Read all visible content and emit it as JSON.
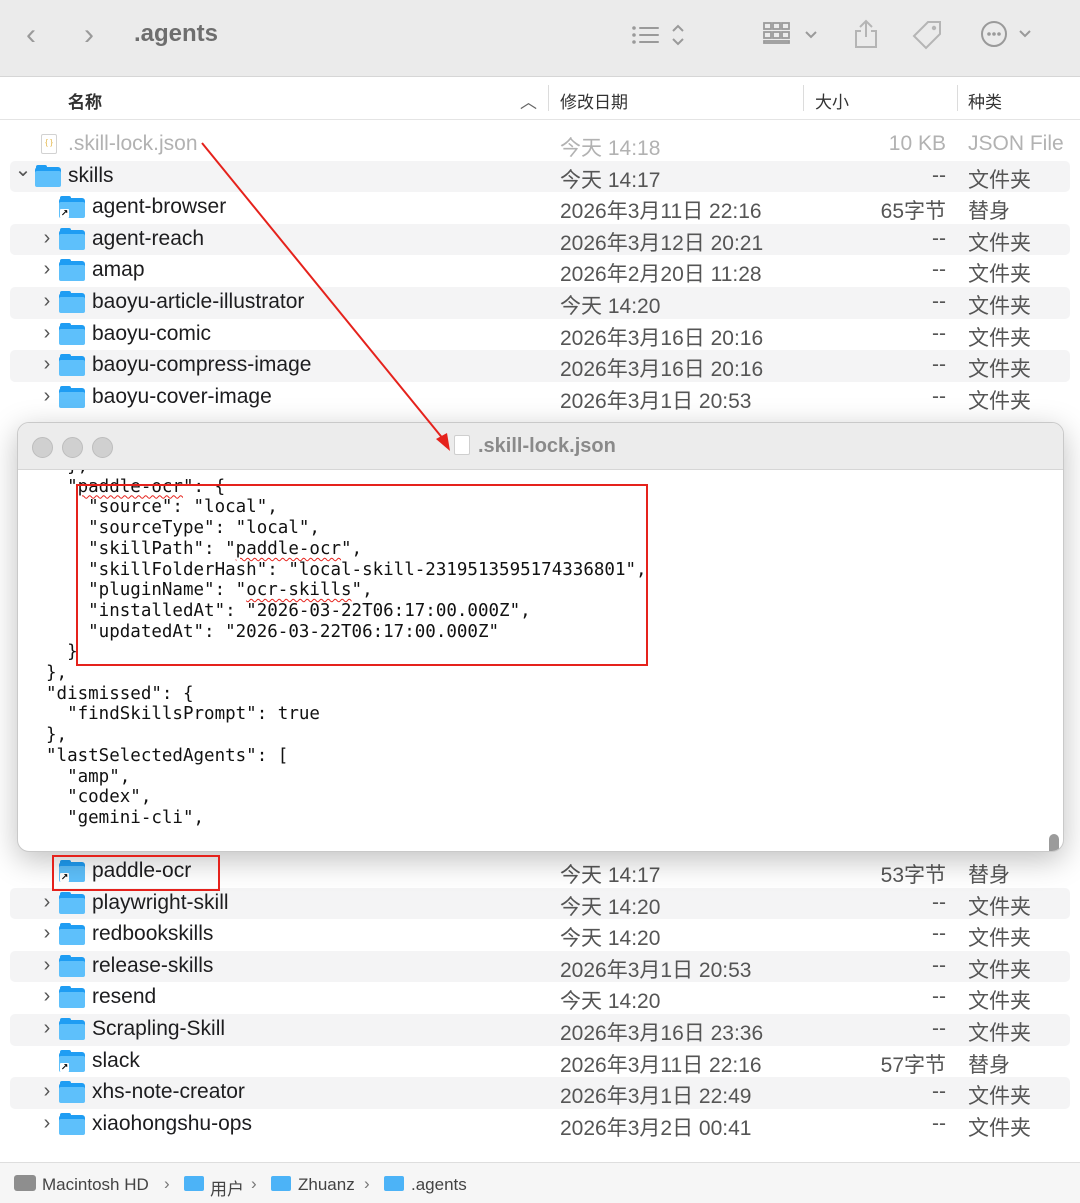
{
  "window": {
    "title": ".agents",
    "back_glyph": "‹",
    "forward_glyph": "›"
  },
  "columns": {
    "name": "名称",
    "date": "修改日期",
    "size": "大小",
    "kind": "种类",
    "sort_glyph": "︿"
  },
  "rows_top": [
    {
      "name": ".skill-lock.json",
      "date": "今天 14:18",
      "size": "10 KB",
      "kind": "JSON File",
      "type": "json",
      "dim": true
    },
    {
      "name": "skills",
      "date": "今天 14:17",
      "size": "--",
      "kind": "文件夹",
      "type": "folder-open"
    },
    {
      "name": "agent-browser",
      "date": "2026年3月11日 22:16",
      "size": "65字节",
      "kind": "替身",
      "type": "alias"
    },
    {
      "name": "agent-reach",
      "date": "2026年3月12日 20:21",
      "size": "--",
      "kind": "文件夹",
      "type": "folder"
    },
    {
      "name": "amap",
      "date": "2026年2月20日 11:28",
      "size": "--",
      "kind": "文件夹",
      "type": "folder"
    },
    {
      "name": "baoyu-article-illustrator",
      "date": "今天 14:20",
      "size": "--",
      "kind": "文件夹",
      "type": "folder"
    },
    {
      "name": "baoyu-comic",
      "date": "2026年3月16日 20:16",
      "size": "--",
      "kind": "文件夹",
      "type": "folder"
    },
    {
      "name": "baoyu-compress-image",
      "date": "2026年3月16日 20:16",
      "size": "--",
      "kind": "文件夹",
      "type": "folder"
    },
    {
      "name": "baoyu-cover-image",
      "date": "2026年3月1日 20:53",
      "size": "--",
      "kind": "文件夹",
      "type": "folder"
    }
  ],
  "rows_bottom": [
    {
      "name": "paddle-ocr",
      "date": "今天 14:17",
      "size": "53字节",
      "kind": "替身",
      "type": "alias"
    },
    {
      "name": "playwright-skill",
      "date": "今天 14:20",
      "size": "--",
      "kind": "文件夹",
      "type": "folder"
    },
    {
      "name": "redbookskills",
      "date": "今天 14:20",
      "size": "--",
      "kind": "文件夹",
      "type": "folder"
    },
    {
      "name": "release-skills",
      "date": "2026年3月1日 20:53",
      "size": "--",
      "kind": "文件夹",
      "type": "folder"
    },
    {
      "name": "resend",
      "date": "今天 14:20",
      "size": "--",
      "kind": "文件夹",
      "type": "folder"
    },
    {
      "name": "Scrapling-Skill",
      "date": "2026年3月16日 23:36",
      "size": "--",
      "kind": "文件夹",
      "type": "folder"
    },
    {
      "name": "slack",
      "date": "2026年3月11日 22:16",
      "size": "57字节",
      "kind": "替身",
      "type": "alias"
    },
    {
      "name": "xhs-note-creator",
      "date": "2026年3月1日 22:49",
      "size": "--",
      "kind": "文件夹",
      "type": "folder"
    },
    {
      "name": "xiaohongshu-ops",
      "date": "2026年3月2日 00:41",
      "size": "--",
      "kind": "文件夹",
      "type": "folder"
    }
  ],
  "editor": {
    "title": ".skill-lock.json",
    "lines": [
      "  },",
      "  \"paddle-ocr\": {",
      "    \"source\": \"local\",",
      "    \"sourceType\": \"local\",",
      "    \"skillPath\": \"paddle-ocr\",",
      "    \"skillFolderHash\": \"local-skill-2319513595174336801\",",
      "    \"pluginName\": \"ocr-skills\",",
      "    \"installedAt\": \"2026-03-22T06:17:00.000Z\",",
      "    \"updatedAt\": \"2026-03-22T06:17:00.000Z\"",
      "  }",
      "},",
      "\"dismissed\": {",
      "  \"findSkillsPrompt\": true",
      "},",
      "\"lastSelectedAgents\": [",
      "  \"amp\",",
      "  \"codex\",",
      "  \"gemini-cli\","
    ]
  },
  "pathbar": {
    "items": [
      "Macintosh HD",
      "用户",
      "Zhuanz",
      ".agents"
    ],
    "separator": "›"
  },
  "colors": {
    "annotation_red": "#e5221c",
    "folder_blue": "#1f9df3"
  },
  "icons": [
    "chevron-left-icon",
    "chevron-right-icon",
    "list-view-icon",
    "grid-view-icon",
    "share-icon",
    "tag-icon",
    "more-icon"
  ]
}
